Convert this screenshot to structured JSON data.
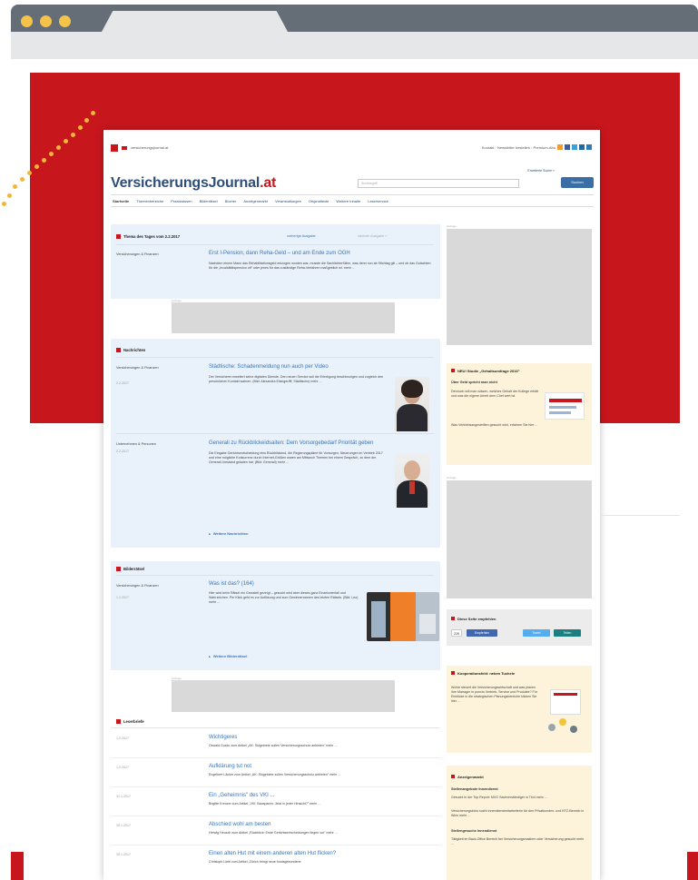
{
  "browser": {
    "accent": "#f6c34a",
    "chrome_color": "#656d77",
    "brand_red": "#c8161d"
  },
  "site": {
    "menu_icon": "hamburger-icon",
    "domain_label": "versicherungsjournal.at",
    "top_links": "Kontakt · Newsletter bestellen · Premium-Abo",
    "rss_label": "RSS",
    "logo_main": "VersicherungsJournal",
    "logo_tld": ".at",
    "extended_search": "Erweiterte Suche »",
    "search_placeholder": "Suchbegriff",
    "search_button": "Suchen",
    "nav": [
      "Startseite",
      "Themenbereiche",
      "Praxiswissen",
      "Bilderrätsel",
      "Bücher",
      "Anzeigenmarkt",
      "Veranstaltungen",
      "Originaltexte",
      "Weitere Inhalte",
      "Leserservice"
    ],
    "theme": {
      "title": "Thema des Tages vom 2.2.2017",
      "prev": "vorherige Ausgabe",
      "next": "nächste Ausgabe »",
      "category": "Versicherungen & Finanzen",
      "headline": "Erst I-Pension, dann Reha-Geld – und am Ende zum OGH",
      "text": "Nachdem einem Mann das Rehabilitationsgeld entzogen worden war, musste die Sachlichterfüllen, was denn nun ab Stichtag gilt – und ob das Gutachten für die „Invaliditätspension oft\" oder jenes für das zuständige Reha-Verfahren maßgeblich ist. mehr ..."
    },
    "ad_label": "Anzeige",
    "news": {
      "title": "Nachrichten",
      "items": [
        {
          "category": "Versicherungen & Finanzen",
          "date": "2.2.2017",
          "headline": "Städtische: Schadenmeldung nun auch per Video",
          "text": "Der Versicherer erweitert seine digitalen Dienste. Den neuen Service soll die Erledigung beschleunigen und zugleich den persönlichen Kontakt wahren. (Bild: Alexandra Eisinger/fff; Städtische) mehr ..."
        },
        {
          "category": "Unternehmen & Personen",
          "date": "2.2.2017",
          "headline": "Generali zu Rückblickeidsaiten: Dem Vorsorgebedarf Priorität geben",
          "text": "Die Eingabe Gerichtsentscheidung eins Rückblickend, die Regierungspläne für Vorsorgen, Neuerungen im Vertrieb 2017 und eine mögliche Konkurrenz durch Internet-Größen waren am Mittwoch Themen bei einem Gespräch, zu dem der Generali-Vorstand geladen hat. (Bild: Generali) mehr ..."
        }
      ],
      "more": "Weitere Nachrichten"
    },
    "quiz": {
      "title": "Bilderrätsel",
      "category": "Versicherungen & Finanzen",
      "date": "1.2.2017",
      "headline": "Was ist das? (164)",
      "text": "Hier wird beim Rätsel ein Grossteil gezeigt – gesucht wird aber dieses ganz Einzelunterfall und Wahrzeichen. Per Klick geht es zur Auflösung und zum Gewinnernamen des letzten Rätsels. (Bild: Leo) mehr ...",
      "more": "Weitere Bilderrätsel"
    },
    "letters": {
      "title": "Leserbriefe",
      "items": [
        {
          "date": "1.2.2017",
          "headline": "Wichtigeres",
          "text": "Oswald Gosko zum Artikel „AK: Skigebiete sollen Versicherungsschutz anbieten\" mehr ..."
        },
        {
          "date": "1.2.2017",
          "headline": "Aufklärung tut not",
          "text": "Engelbert Läcker zum Artikel „AK: Skigebiete sollen Versicherungsschutz anbieten\" mehr ..."
        },
        {
          "date": "31.1.2017",
          "headline": "Ein „Geheimnis\" des VKI ...",
          "text": "Brigitte Kreuzer zum Artikel „VKI: Bausparen: Jetzt in jeder Hinsicht?\" mehr ..."
        },
        {
          "date": "30.1.2017",
          "headline": "Abschied wohl am besten",
          "text": "Herwig Heusch zum Artikel „Rückblick: Erste Gerichtsentscheidungen liegen vor\" mehr ..."
        },
        {
          "date": "30.1.2017",
          "headline": "Einen alten Hut mit einem anderen alten Hut flicken?",
          "text": "Christoph Liebl zum Artikel „Zürich bringt neue fondsgebundene"
        }
      ]
    },
    "sidebar": {
      "study_title": "NEU! Studie „Gehaltsumfrage 2016\"",
      "study_sub": "Über Geld spricht man nicht",
      "study_text1": "Dennoch will man wissen, welches Gehalt der Kollege erhält und was die eigene Arbeit dem Chef wert ist.",
      "study_text2": "Was Vertriebsangestellten gesucht wird, erfahren Sie hier ...",
      "recommend_title": "Diese Seite empfehlen",
      "recommend_count": "228",
      "share_like": "Empfehlen",
      "share_tweet": "Tweet",
      "share_other": "Teilen",
      "workshop_title": "Kooperationsfeld: neben Tuchele",
      "workshop_text": "Wohin steuert die Versicherungswirtschaft und was planen ihre Manager in puncto Vertrieb, Service und Produkte? Für Einblicke in die strategischen Planungsbereiche klicken Sie hier ...",
      "market_title": "Anzeigenmarkt",
      "market_sub": "Stellenangebote Innendienst",
      "market_text1": "Gesucht in der Top Report: MVG Sachverständiger in Tirol mehr ...",
      "market_text2": "Versicherungsbüro sucht Innendienstmitarbeiterin für den Privatkunden- und KFZ-Bereich in Wien mehr ...",
      "market_sub2": "Stellengesuche Innendienst",
      "market_text3": "Tätigkeit im Back-Office Bereich bei Versicherungsmaklern oder Versicherung gesucht mehr ..."
    }
  }
}
